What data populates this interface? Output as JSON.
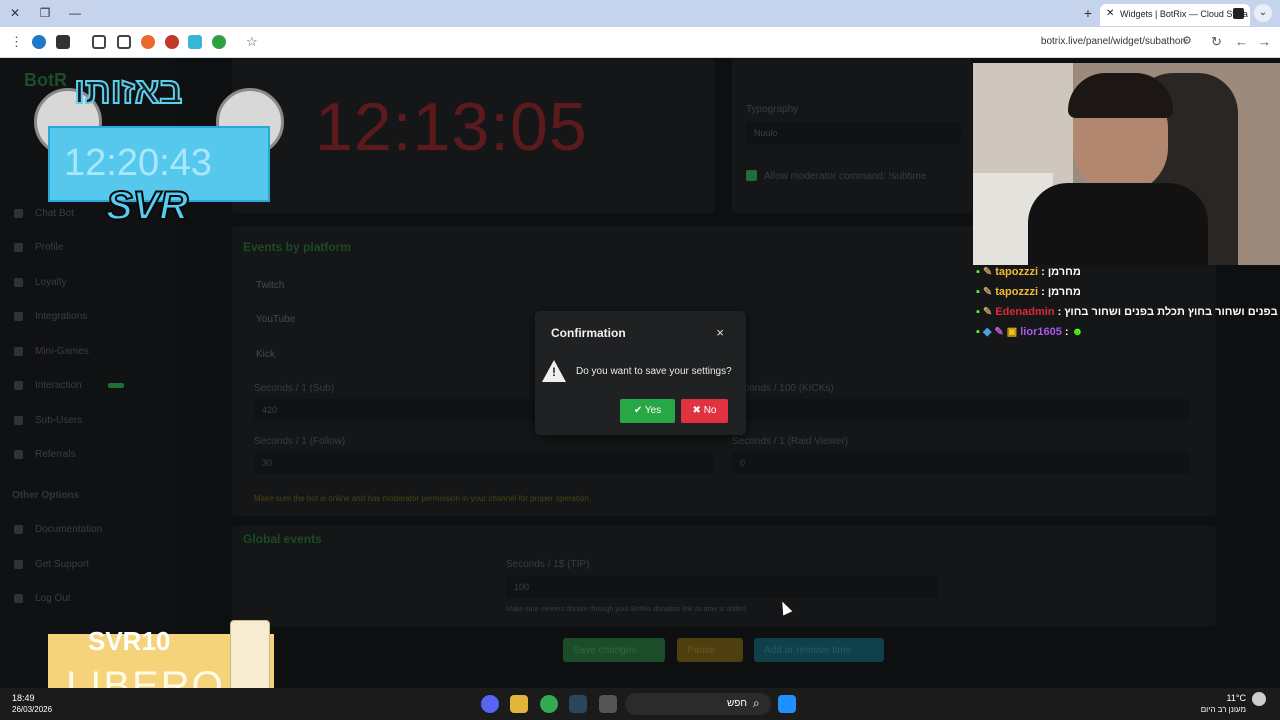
{
  "browser": {
    "tab_title": "Widgets | BotRix — Cloud Strea",
    "url": "botrix.live/panel/widget/subathon",
    "new_tab": "+",
    "close": "✕",
    "menu": "⌄"
  },
  "sidebar": {
    "brand": "BotR",
    "items": [
      {
        "label": "Chat Bot"
      },
      {
        "label": "Profile"
      },
      {
        "label": "Loyalty"
      },
      {
        "label": "Integrations"
      },
      {
        "label": "Mini-Games"
      },
      {
        "label": "Interaction"
      },
      {
        "label": "Sub-Users"
      },
      {
        "label": "Referrals"
      }
    ],
    "other_heading": "Other Options",
    "other_items": [
      {
        "label": "Documentation"
      },
      {
        "label": "Get Support"
      },
      {
        "label": "Log Out"
      }
    ]
  },
  "main": {
    "big_clock": "12:13:05",
    "typography_label": "Typography",
    "typography_value": "Nuulo",
    "moderator_command": "Allow moderator command: !subtime",
    "events_heading": "Events by platform",
    "platforms": [
      "Twitch",
      "YouTube",
      "Kick"
    ],
    "sub_label": "Seconds / 1 (Sub)",
    "sub_value": "420",
    "kicks_label": "Seconds / 100 (KICKs)",
    "kicks_value": "0",
    "follow_label": "Seconds / 1 (Follow)",
    "follow_value": "30",
    "raid_label": "Seconds / 1 (Raid Viewer)",
    "raid_value": "0",
    "bot_note": "Make sure the bot is online and has moderator permission in your channel for proper operation.",
    "global_heading": "Global events",
    "tip_label": "Seconds / 1$ (TIP)",
    "tip_value": "100",
    "tip_note": "Make sure viewers donate through your BotRix donation link so time is added.",
    "save_button": "Save changes",
    "pause_button": "Pause",
    "add_time_button": "Add or remove time"
  },
  "overlay": {
    "timer": "12:20:43",
    "brand_text": "SVR",
    "hebrew_title": "באזותו"
  },
  "chat": [
    {
      "user": "tapozzzi",
      "user_color": "#f5b833",
      "message": ": מחרמן"
    },
    {
      "user": "tapozzzi",
      "user_color": "#f5b833",
      "message": ": מחרמן"
    },
    {
      "user": "Edenadmin",
      "user_color": "#e0283a",
      "message": ": תכלת בפנים ושחור בחוץ תכלת בפנים ושחור בחוץ"
    },
    {
      "user": "lior1605",
      "user_color": "#a95ae6",
      "message": ":"
    }
  ],
  "modal": {
    "title": "Confirmation",
    "close": "×",
    "message": "Do you want to save your settings?",
    "yes_label": "Yes",
    "no_label": "No",
    "yes_color": "#28a745",
    "no_color": "#e0323f"
  },
  "promo": {
    "code": "SVR10",
    "brand": "LIBERO"
  },
  "taskbar": {
    "time": "18:49",
    "date": "26/03/2026",
    "search": "חפש",
    "weather_temp": "11°C",
    "weather_text": "מעונן רב היום"
  }
}
